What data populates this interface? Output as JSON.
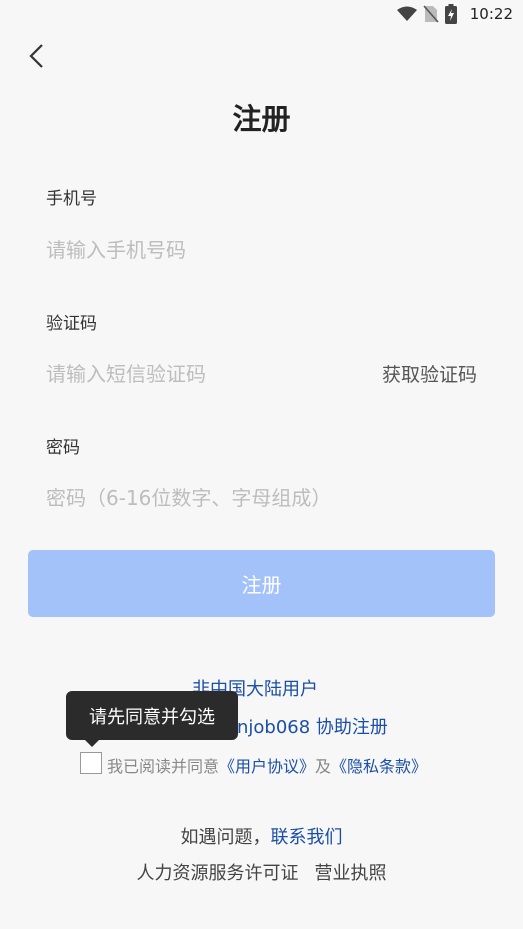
{
  "status_bar": {
    "time": "10:22"
  },
  "page": {
    "title": "注册"
  },
  "phone": {
    "label": "手机号",
    "placeholder": "请输入手机号码"
  },
  "code": {
    "label": "验证码",
    "placeholder": "请输入短信验证码",
    "get_code": "获取验证码"
  },
  "password": {
    "label": "密码",
    "placeholder": "密码（6-16位数字、字母组成）"
  },
  "register_button": "注册",
  "non_mainland": {
    "line1": "非中国大陆用户",
    "line2_visible": "njob068 协助注册"
  },
  "tooltip": "请先同意并勾选",
  "agreement": {
    "prefix": "我已阅读并同意",
    "user_agreement": "《用户协议》",
    "and": "及",
    "privacy": "《隐私条款》",
    "checked": false
  },
  "help": {
    "prefix": "如遇问题，",
    "contact": "联系我们"
  },
  "footer": {
    "license": "人力资源服务许可证",
    "business": "营业执照"
  },
  "colors": {
    "primary_disabled": "#a3c2fa",
    "link": "#1a4fa8",
    "tooltip_bg": "#2b2b2b"
  }
}
